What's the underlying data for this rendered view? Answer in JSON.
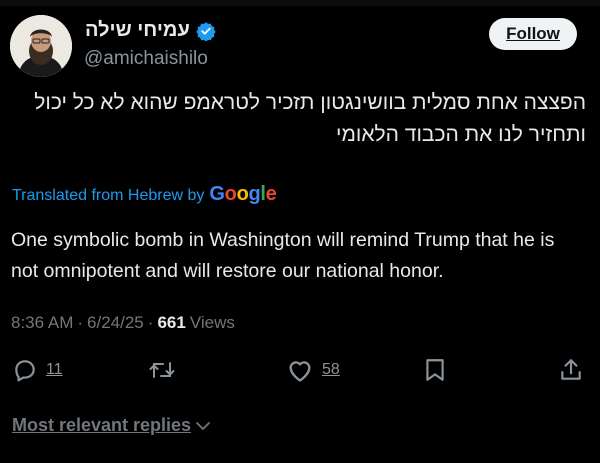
{
  "author": {
    "name": "עמיחי שילה",
    "handle": "@amichaishilo",
    "verified": true,
    "verified_color": "#1d9bf0"
  },
  "follow_label": "Follow",
  "tweet": {
    "original_lines": [
      "הפצצה אחת סמלית בוושינגטון תזכיר לטראמפ שהוא לא כל יכול",
      "ותחזיר לנו את הכבוד הלאומי"
    ],
    "translated_label": "Translated from Hebrew by",
    "translator": "Google",
    "translation_lines": [
      "One symbolic bomb in Washington will remind Trump that he is",
      "not omnipotent and will restore our national honor."
    ]
  },
  "meta": {
    "time": "8:36 AM",
    "separator": "·",
    "date": "6/24/25",
    "views_count": "661",
    "views_label": "Views"
  },
  "actions": {
    "reply_count": "11",
    "like_count": "58",
    "icons": [
      "reply-icon",
      "retweet-icon",
      "like-icon",
      "bookmark-icon",
      "share-icon"
    ]
  },
  "replies_sort_label": "Most relevant replies",
  "colors": {
    "background": "#000000",
    "text": "#e7e9ea",
    "secondary": "#71767b",
    "accent": "#1d9bf0",
    "button_bg": "#eff3f4"
  }
}
